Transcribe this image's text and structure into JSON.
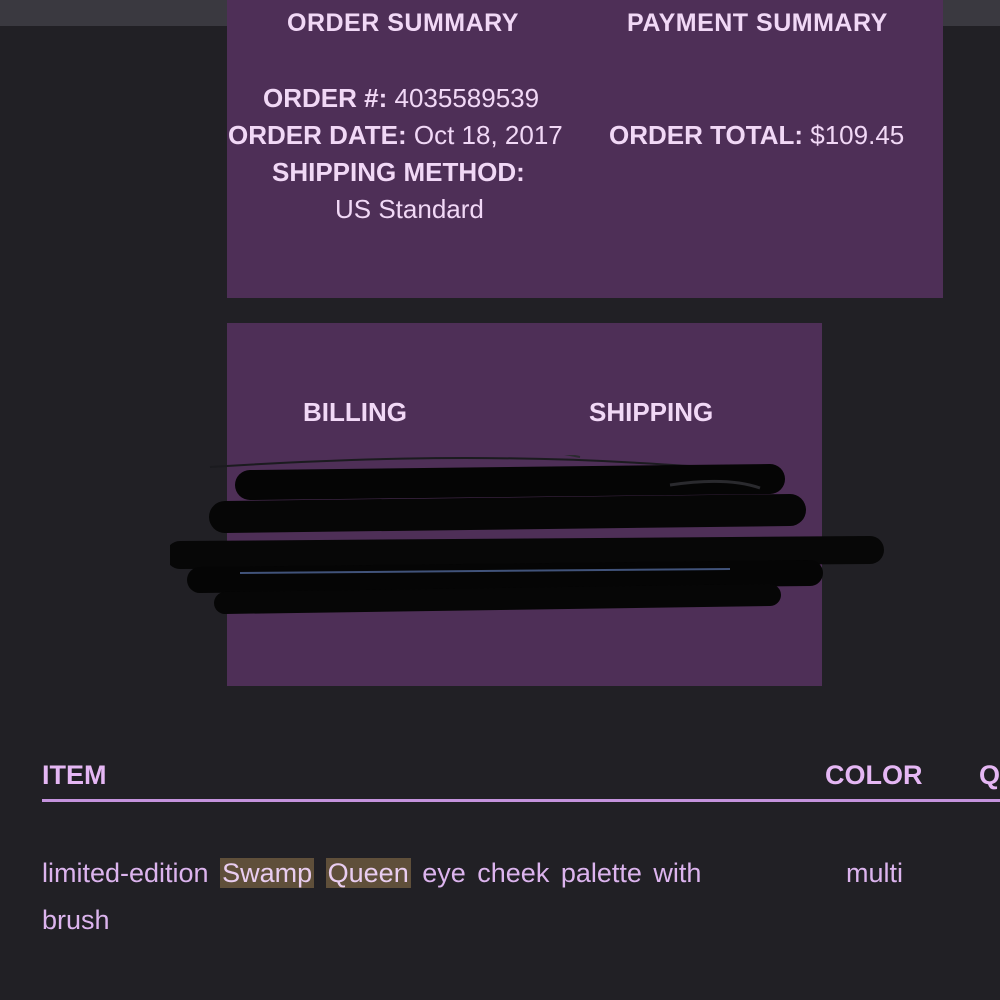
{
  "order_summary": {
    "heading": "ORDER SUMMARY",
    "order_number_label": "ORDER #:",
    "order_number": "4035589539",
    "order_date_label": "ORDER DATE:",
    "order_date": "Oct 18, 2017",
    "shipping_method_label": "SHIPPING METHOD:",
    "shipping_method": "US Standard"
  },
  "payment_summary": {
    "heading": "PAYMENT SUMMARY",
    "order_total_label": "ORDER TOTAL:",
    "order_total": "$109.45"
  },
  "addresses": {
    "billing_heading": "BILLING",
    "shipping_heading": "SHIPPING"
  },
  "items_table": {
    "headers": [
      "ITEM",
      "COLOR",
      "Q"
    ],
    "rows": [
      {
        "desc_before": "limited-edition",
        "highlight_1": "Swamp",
        "highlight_2": "Queen",
        "desc_after": "eye cheek palette with brush",
        "color": "multi"
      }
    ]
  },
  "colors": {
    "background": "#212025",
    "panel": "#4e2f57",
    "panel_text": "#f1d8f6",
    "table_text": "#dcb4ee",
    "rule": "#c493dd",
    "search_highlight": "#5f4f3a"
  }
}
